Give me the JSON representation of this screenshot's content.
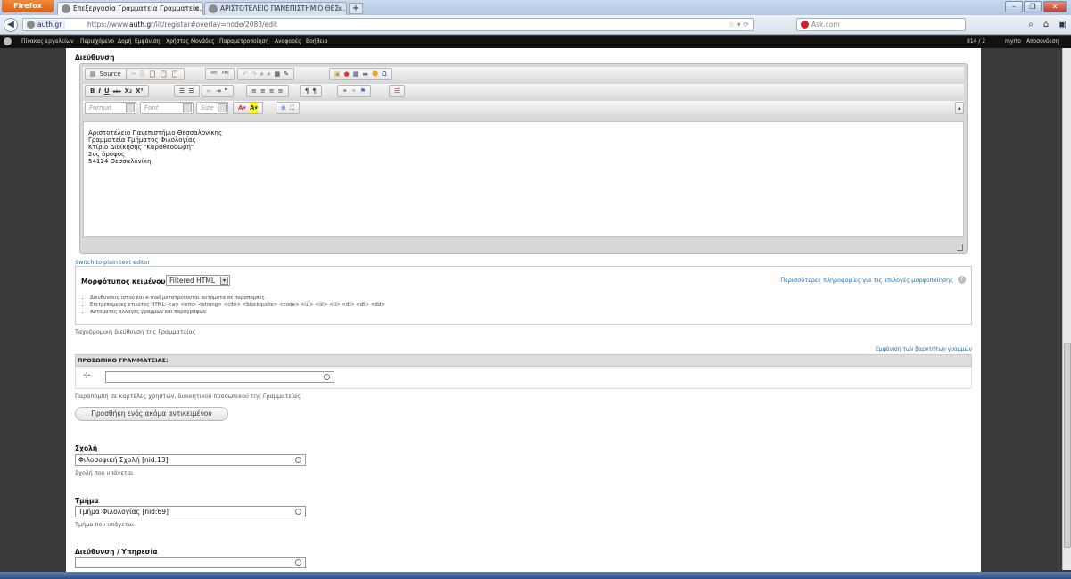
{
  "browser": {
    "menu_label": "Firefox",
    "tabs": [
      {
        "title": "Επεξεργασία Γραμματεία Γραμματεία..."
      },
      {
        "title": "ΑΡΙΣΤΟΤΕΛΕΙΟ ΠΑΝΕΠΙΣΤΗΜΙΟ ΘΕΣ..."
      }
    ],
    "new_tab": "+",
    "url_site": "auth.gr",
    "url_prefix": "https://www.",
    "url_domain": "auth.gr",
    "url_path": "/lit/registar#overlay=node/2083/edit",
    "search_placeholder": "Ask.com"
  },
  "admin_bar": {
    "items": [
      "Πίνακας εργαλείων",
      "Περιεχόμενο",
      "Δομή",
      "Εμφάνιση",
      "Χρήστες",
      "Μονάδες",
      "Παραμετροποίηση",
      "Αναφορές",
      "Βοήθεια"
    ],
    "user_count": "814 / 2",
    "user": "myrto",
    "logout": "Αποσύνδεση"
  },
  "form": {
    "address_label": "Διεύθυνση",
    "toolbar": {
      "source": "Source",
      "format_placeholder": "Format",
      "font_placeholder": "Font",
      "size_placeholder": "Size"
    },
    "address_lines": [
      "Αριστοτέλειο Πανεπιστήμιο Θεσσαλονίκης",
      "Γραμματεία Τμήματος Φιλολογίας",
      "Κτίριο Διοίκησης \"Καραθεοδωρή\"",
      "2ος όροφος",
      "54124 Θεσσαλονίκη"
    ],
    "plain_text_link": "Switch to plain text editor",
    "text_format_label": "Μορφότυπος κειμένου",
    "text_format_value": "Filtered HTML",
    "format_help_link": "Περισσότερες πληροφορίες για τις επιλογές μορφοποίησης",
    "format_tips": [
      "Διευθύνσεις ιστού και e-mail μετατρέπονται αυτόματα σε παραπομπές.",
      "Επιτρεπόμενες ετικέτες HTML: <a> <em> <strong> <cite> <blockquote> <code> <ul> <ol> <li> <dl> <dt> <dd>",
      "Αυτόματες αλλαγές γραμμών και παραγράφων."
    ],
    "address_desc": "Ταχυδρομική διεύθυνση της Γραμματείας",
    "weights_link": "Εμφάνιση των βαρυτήτων γραμμών",
    "staff_header": "ΠΡΟΣΩΠΙΚΟ ΓΡΑΜΜΑΤΕΙΑΣ:",
    "staff_value": "",
    "staff_desc": "Παραπομπή σε καρτέλες χρηστών, διοικητικού προσωπικού της Γραμματείας",
    "add_button": "Προσθήκη ενός ακόμα αντικειμένου",
    "school_label": "Σχολή",
    "school_value": "Φιλοσοφική Σχολή [nid:13]",
    "school_desc": "Σχολή που υπάγεται",
    "dept_label": "Τμήμα",
    "dept_value": "Τμήμα Φιλολογίας [nid:69]",
    "dept_desc": "Τμήμα που υπάγεται",
    "service_label": "Διεύθυνση / Υπηρεσία",
    "service_value": ""
  }
}
